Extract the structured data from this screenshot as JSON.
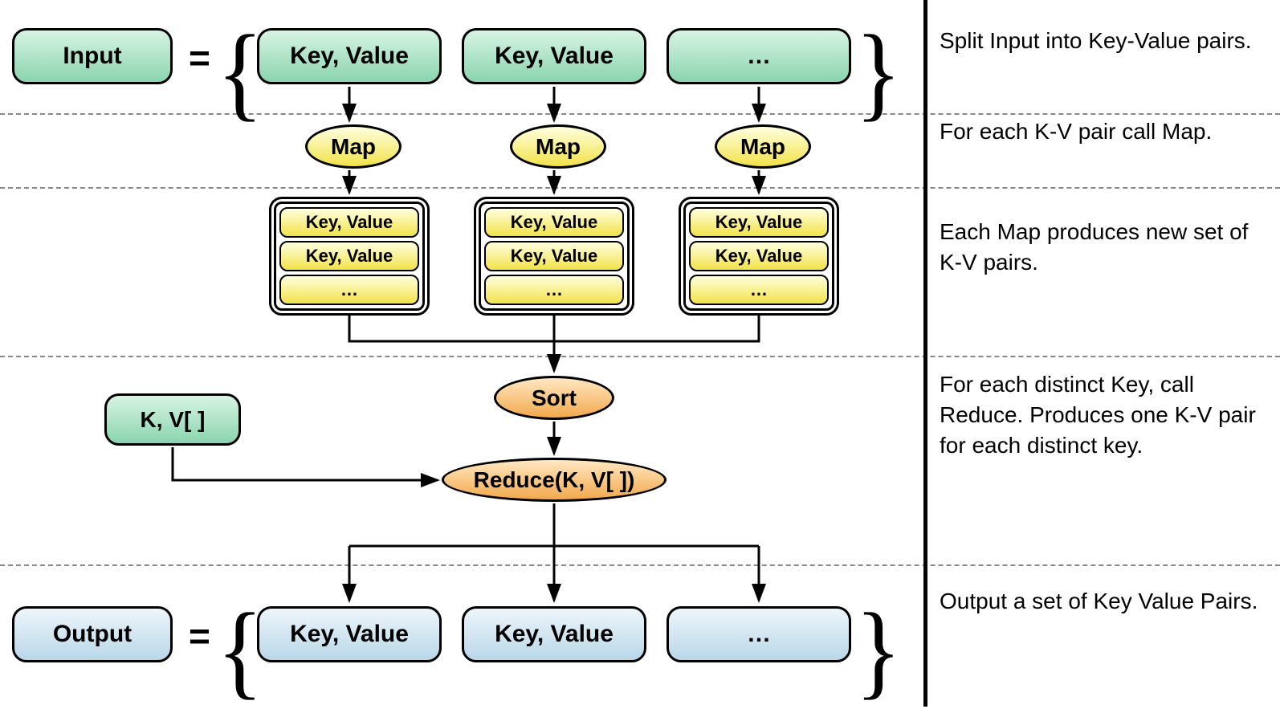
{
  "labels": {
    "input": "Input",
    "output": "Output",
    "keyvalue": "Key, Value",
    "ellipsis": "…",
    "map": "Map",
    "sort": "Sort",
    "reduce": "Reduce(K, V[ ])",
    "kv_array": "K, V[ ]",
    "equals": "="
  },
  "descriptions": {
    "split": "Split Input into Key-Value pairs.",
    "map": "For each K-V pair call Map.",
    "produce": "Each Map produces new set of K-V pairs.",
    "reduce": "For each distinct Key, call Reduce. Produces one K-V pair for each distinct key.",
    "output": "Output a set of Key Value Pairs."
  }
}
